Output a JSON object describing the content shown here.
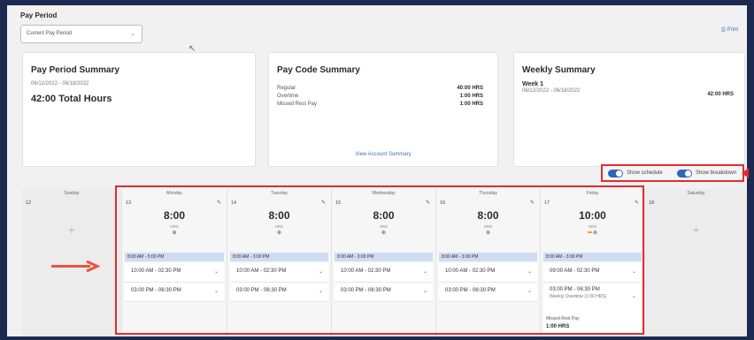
{
  "header": {
    "title": "Pay Period",
    "select_value": "Current Pay Period",
    "print_label": "Print"
  },
  "summary": {
    "title": "Pay Period Summary",
    "date_range": "06/12/2022 - 06/18/2022",
    "total": "42:00 Total Hours"
  },
  "pay_code": {
    "title": "Pay Code Summary",
    "rows": [
      {
        "label": "Regular",
        "value": "40:00 HRS"
      },
      {
        "label": "Overtime",
        "value": "1:00 HRS"
      },
      {
        "label": "Missed Rest Pay",
        "value": "1:00 HRS"
      }
    ],
    "view_link": "View Account Summary"
  },
  "weekly": {
    "title": "Weekly Summary",
    "week_label": "Week 1",
    "date_range": "06/12/2022 - 06/18/2022",
    "hours": "42:00 HRS"
  },
  "toggles": {
    "schedule_label": "Show schedule",
    "breakdown_label": "Show breakdown"
  },
  "calendar": {
    "hrs_label": "HRS",
    "days": [
      {
        "name": "Sunday",
        "num": "12"
      },
      {
        "name": "Monday",
        "num": "13",
        "hours": "8:00",
        "schedule": "8:00 AM - 5:00 PM",
        "shifts": [
          "10:00 AM - 02:30 PM",
          "03:00 PM - 06:30 PM"
        ]
      },
      {
        "name": "Tuesday",
        "num": "14",
        "hours": "8:00",
        "schedule": "8:00 AM - 3:00 PM",
        "shifts": [
          "10:00 AM - 02:30 PM",
          "03:00 PM - 06:30 PM"
        ]
      },
      {
        "name": "Wednesday",
        "num": "15",
        "hours": "8:00",
        "schedule": "8:00 AM - 3:00 PM",
        "shifts": [
          "10:00 AM - 02:30 PM",
          "03:00 PM - 06:30 PM"
        ]
      },
      {
        "name": "Thursday",
        "num": "16",
        "hours": "8:00",
        "schedule": "8:00 AM - 3:00 PM",
        "shifts": [
          "10:00 AM - 02:30 PM",
          "03:00 PM - 06:30 PM"
        ]
      },
      {
        "name": "Friday",
        "num": "17",
        "hours": "10:00",
        "schedule": "8:00 AM - 3:00 PM",
        "shifts": [
          "09:00 AM - 02:30 PM",
          "03:00 PM - 06:30 PM"
        ],
        "shift_note": "Weekly Overtime (1:00 HRS)",
        "missed_label": "Missed Rest Pay",
        "missed_value": "1:00 HRS"
      },
      {
        "name": "Saturday",
        "num": "18"
      }
    ]
  },
  "colors": {
    "accent": "#2e66b8",
    "highlight_red": "#e02c32",
    "schedule_bg": "#cfdcf2",
    "overtime_marker": "#f0a21b"
  }
}
